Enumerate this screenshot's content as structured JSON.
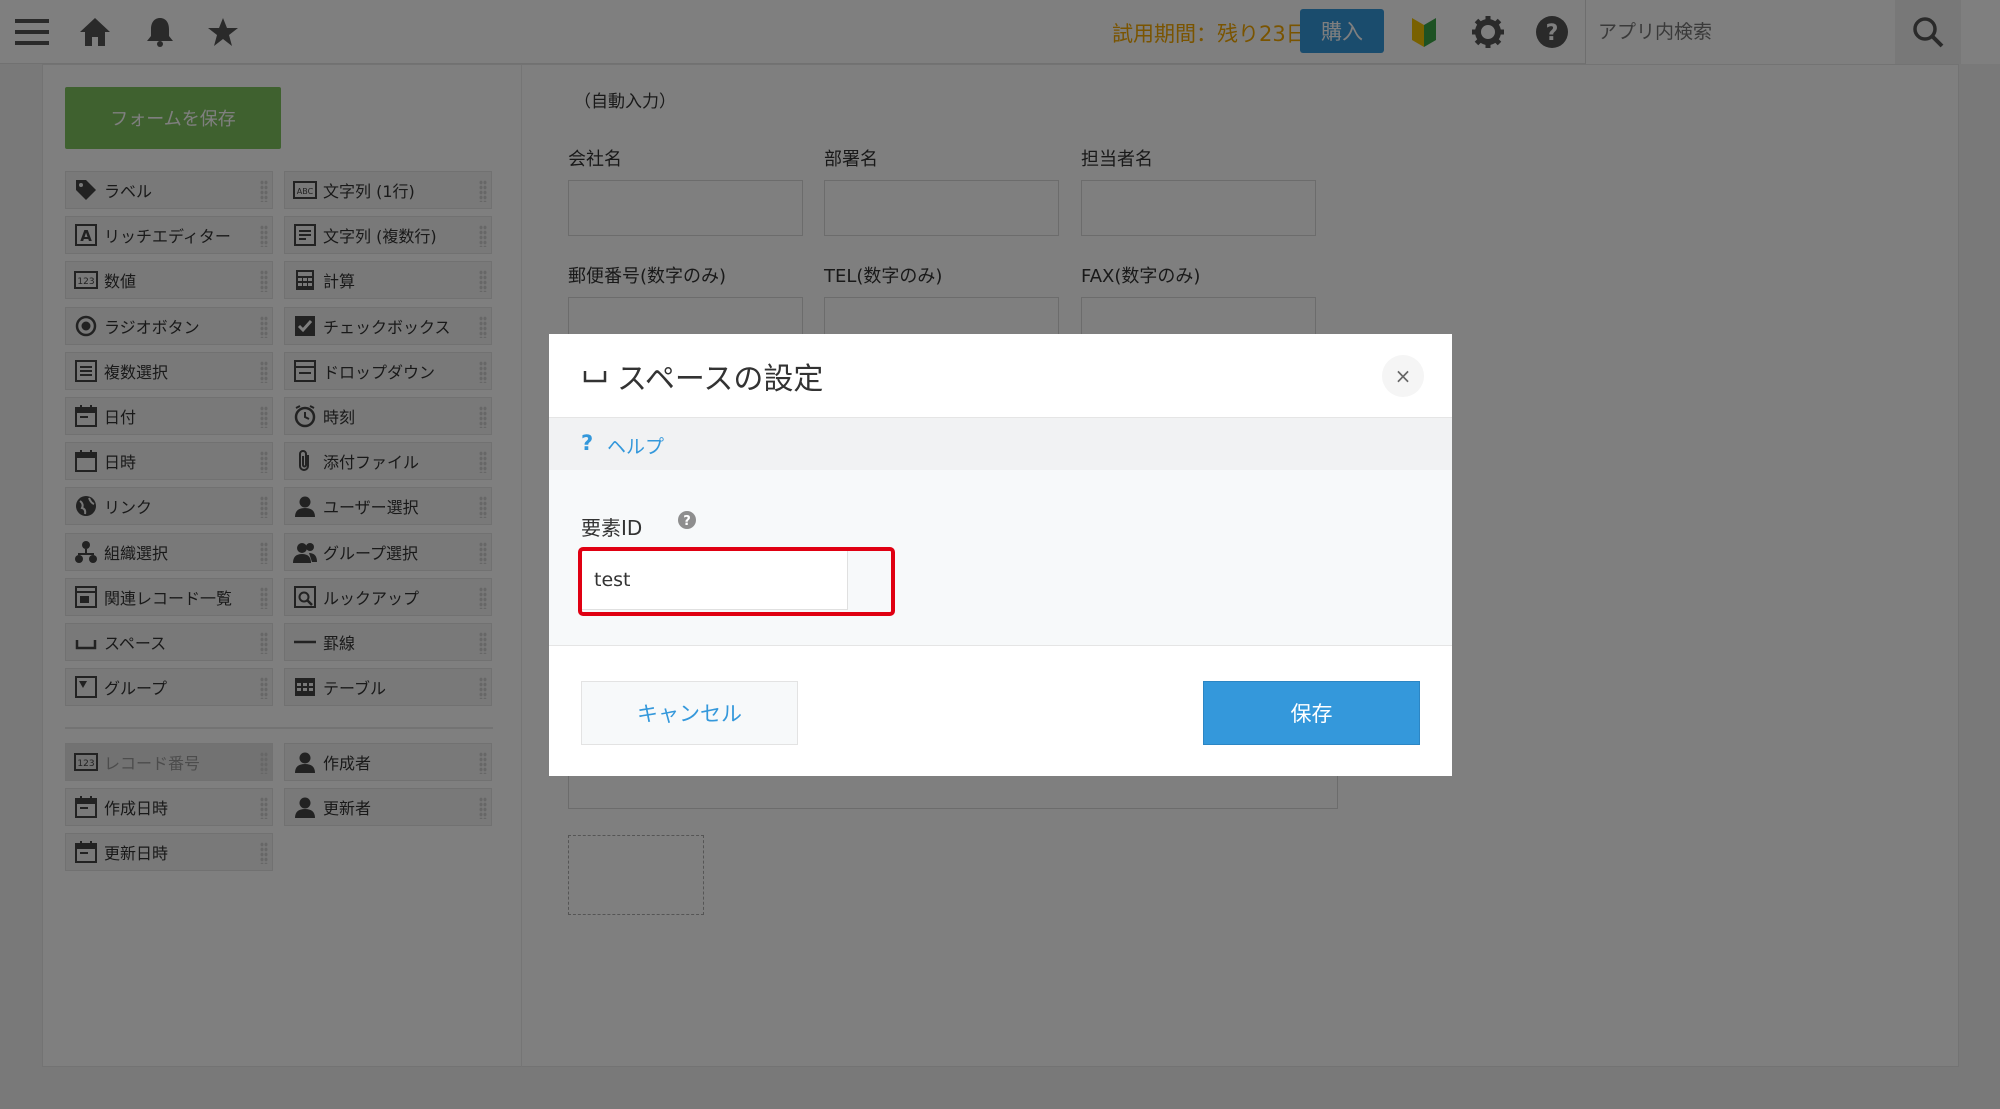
{
  "header": {
    "trial_text": "試用期間：残り23日",
    "buy_label": "購入",
    "search_placeholder": "アプリ内検索",
    "icons": [
      "menu-icon",
      "home-icon",
      "bell-icon",
      "star-icon",
      "beginner-icon",
      "gear-icon",
      "help-icon",
      "search-icon"
    ]
  },
  "palette": {
    "save_form_label": "フォームを保存",
    "items": [
      {
        "label": "ラベル",
        "icon": "tag-icon"
      },
      {
        "label": "文字列 (1行)",
        "icon": "abc-icon"
      },
      {
        "label": "リッチエディター",
        "icon": "rich-editor-icon"
      },
      {
        "label": "文字列 (複数行)",
        "icon": "multiline-icon"
      },
      {
        "label": "数値",
        "icon": "number-icon"
      },
      {
        "label": "計算",
        "icon": "calculator-icon"
      },
      {
        "label": "ラジオボタン",
        "icon": "radio-icon"
      },
      {
        "label": "チェックボックス",
        "icon": "checkbox-icon"
      },
      {
        "label": "複数選択",
        "icon": "multi-select-icon"
      },
      {
        "label": "ドロップダウン",
        "icon": "dropdown-icon"
      },
      {
        "label": "日付",
        "icon": "calendar-icon"
      },
      {
        "label": "時刻",
        "icon": "clock-icon"
      },
      {
        "label": "日時",
        "icon": "datetime-icon"
      },
      {
        "label": "添付ファイル",
        "icon": "paperclip-icon"
      },
      {
        "label": "リンク",
        "icon": "globe-icon"
      },
      {
        "label": "ユーザー選択",
        "icon": "user-icon"
      },
      {
        "label": "組織選択",
        "icon": "org-icon"
      },
      {
        "label": "グループ選択",
        "icon": "group-icon"
      },
      {
        "label": "関連レコード一覧",
        "icon": "related-records-icon"
      },
      {
        "label": "ルックアップ",
        "icon": "lookup-icon"
      },
      {
        "label": "スペース",
        "icon": "space-icon"
      },
      {
        "label": "罫線",
        "icon": "rule-line-icon"
      },
      {
        "label": "グループ",
        "icon": "group-folder-icon"
      },
      {
        "label": "テーブル",
        "icon": "table-icon"
      }
    ],
    "system_items": [
      {
        "label": "レコード番号",
        "icon": "number-icon"
      },
      {
        "label": "作成者",
        "icon": "user-icon"
      },
      {
        "label": "作成日時",
        "icon": "calendar-icon"
      },
      {
        "label": "更新者",
        "icon": "user-icon"
      },
      {
        "label": "更新日時",
        "icon": "calendar-icon"
      }
    ]
  },
  "form": {
    "auto_input": "（自動入力）",
    "fields": [
      "会社名",
      "部署名",
      "担当者名",
      "郵便番号(数字のみ)",
      "TEL(数字のみ)",
      "FAX(数字のみ)"
    ]
  },
  "dialog": {
    "title": "スペースの設定",
    "close_label": "×",
    "help_label": "ヘルプ",
    "element_id_label": "要素ID",
    "element_id_value": "test",
    "cancel_label": "キャンセル",
    "save_label": "保存"
  },
  "colors": {
    "accent": "#3498db",
    "save_form_green": "#7fc25f",
    "trial_orange": "#f5a800",
    "highlight_red": "#e00012"
  }
}
